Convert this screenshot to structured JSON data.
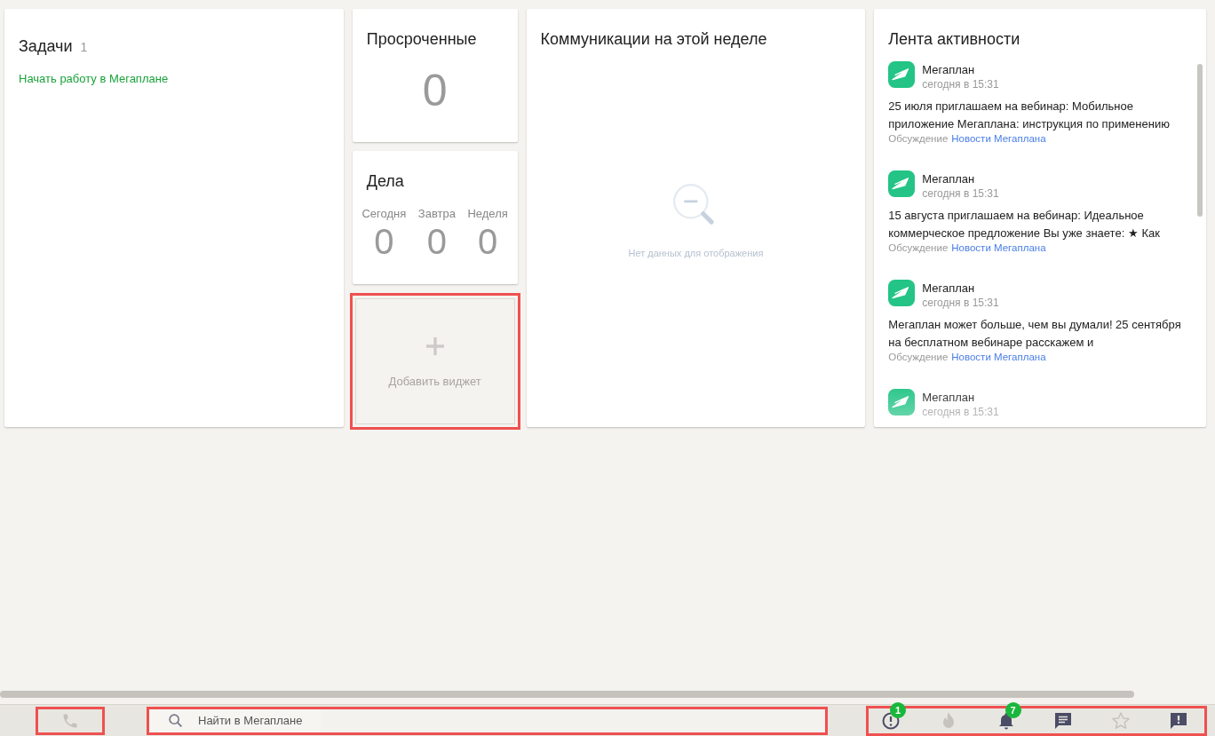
{
  "tasks": {
    "title": "Задачи",
    "count": "1",
    "link": "Начать работу в Мегаплане"
  },
  "overdue": {
    "title": "Просроченные",
    "value": "0"
  },
  "deals": {
    "title": "Дела",
    "columns": [
      {
        "label": "Сегодня",
        "value": "0"
      },
      {
        "label": "Завтра",
        "value": "0"
      },
      {
        "label": "Неделя",
        "value": "0"
      }
    ]
  },
  "add_widget": {
    "label": "Добавить виджет",
    "highlighted": true
  },
  "communications": {
    "title": "Коммуникации на этой неделе",
    "empty_text": "Нет данных для отображения"
  },
  "activity": {
    "title": "Лента активности",
    "items": [
      {
        "author": "Мегаплан",
        "time": "сегодня в 15:31",
        "text": "25 июля приглашаем на вебинар: Мобильное приложение Мегаплана: инструкция по применению",
        "context": "Обсуждение",
        "link": "Новости Мегаплана"
      },
      {
        "author": "Мегаплан",
        "time": "сегодня в 15:31",
        "text": "15 августа приглашаем на вебинар: Идеальное коммерческое предложение Вы уже знаете: ★ Как",
        "context": "Обсуждение",
        "link": "Новости Мегаплана"
      },
      {
        "author": "Мегаплан",
        "time": "сегодня в 15:31",
        "text": "Мегаплан может больше, чем вы думали! 25 сентября на бесплатном вебинаре расскажем и",
        "context": "Обсуждение",
        "link": "Новости Мегаплана"
      },
      {
        "author": "Мегаплан",
        "time": "сегодня в 15:31"
      }
    ]
  },
  "bottom_bar": {
    "phone": {
      "highlighted": true
    },
    "search": {
      "placeholder": "Найти в Мегаплане",
      "highlighted": true
    },
    "icons_highlighted": true,
    "icons": [
      {
        "kind": "alert",
        "badge": "1"
      },
      {
        "kind": "flame"
      },
      {
        "kind": "bell",
        "badge": "7"
      },
      {
        "kind": "chat"
      },
      {
        "kind": "star"
      },
      {
        "kind": "feedback"
      }
    ]
  }
}
